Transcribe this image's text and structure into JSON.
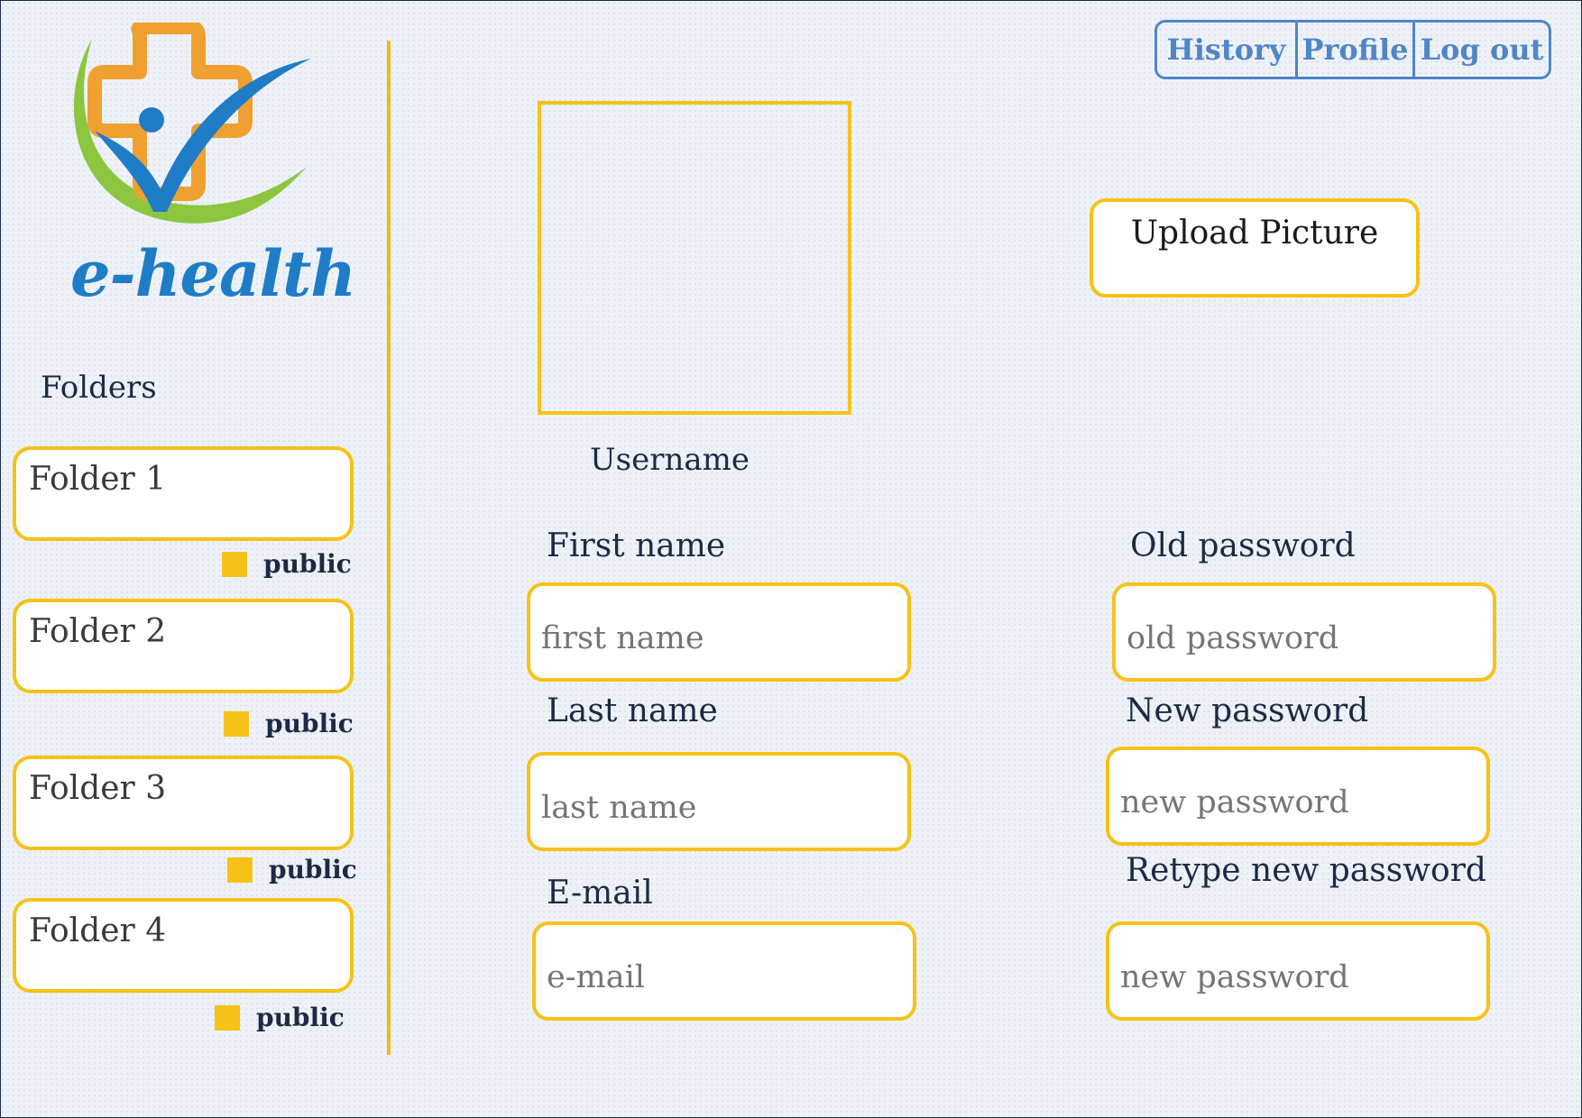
{
  "app": {
    "logo_text": "e-health"
  },
  "nav": {
    "history": "History",
    "profile": "Profile",
    "logout": "Log out"
  },
  "sidebar": {
    "heading": "Folders",
    "folders": [
      {
        "label": "Folder 1",
        "visibility": "public"
      },
      {
        "label": "Folder 2",
        "visibility": "public"
      },
      {
        "label": "Folder 3",
        "visibility": "public"
      },
      {
        "label": "Folder 4",
        "visibility": "public"
      }
    ]
  },
  "profile": {
    "upload_button": "Upload Picture",
    "username": "Username"
  },
  "form": {
    "first_name": {
      "label": "First name",
      "placeholder": "first name"
    },
    "last_name": {
      "label": "Last name",
      "placeholder": "last name"
    },
    "email": {
      "label": "E-mail",
      "placeholder": "e-mail"
    },
    "old_password": {
      "label": "Old password",
      "placeholder": "old password"
    },
    "new_password": {
      "label": "New password",
      "placeholder": "new password"
    },
    "retype_password": {
      "label": "Retype new password",
      "placeholder": "new password"
    }
  },
  "colors": {
    "accent": "#f6c218",
    "nav": "#4f86c6",
    "logo_blue": "#1f7cc6",
    "logo_orange": "#f0a030",
    "logo_green": "#8cc63e"
  }
}
